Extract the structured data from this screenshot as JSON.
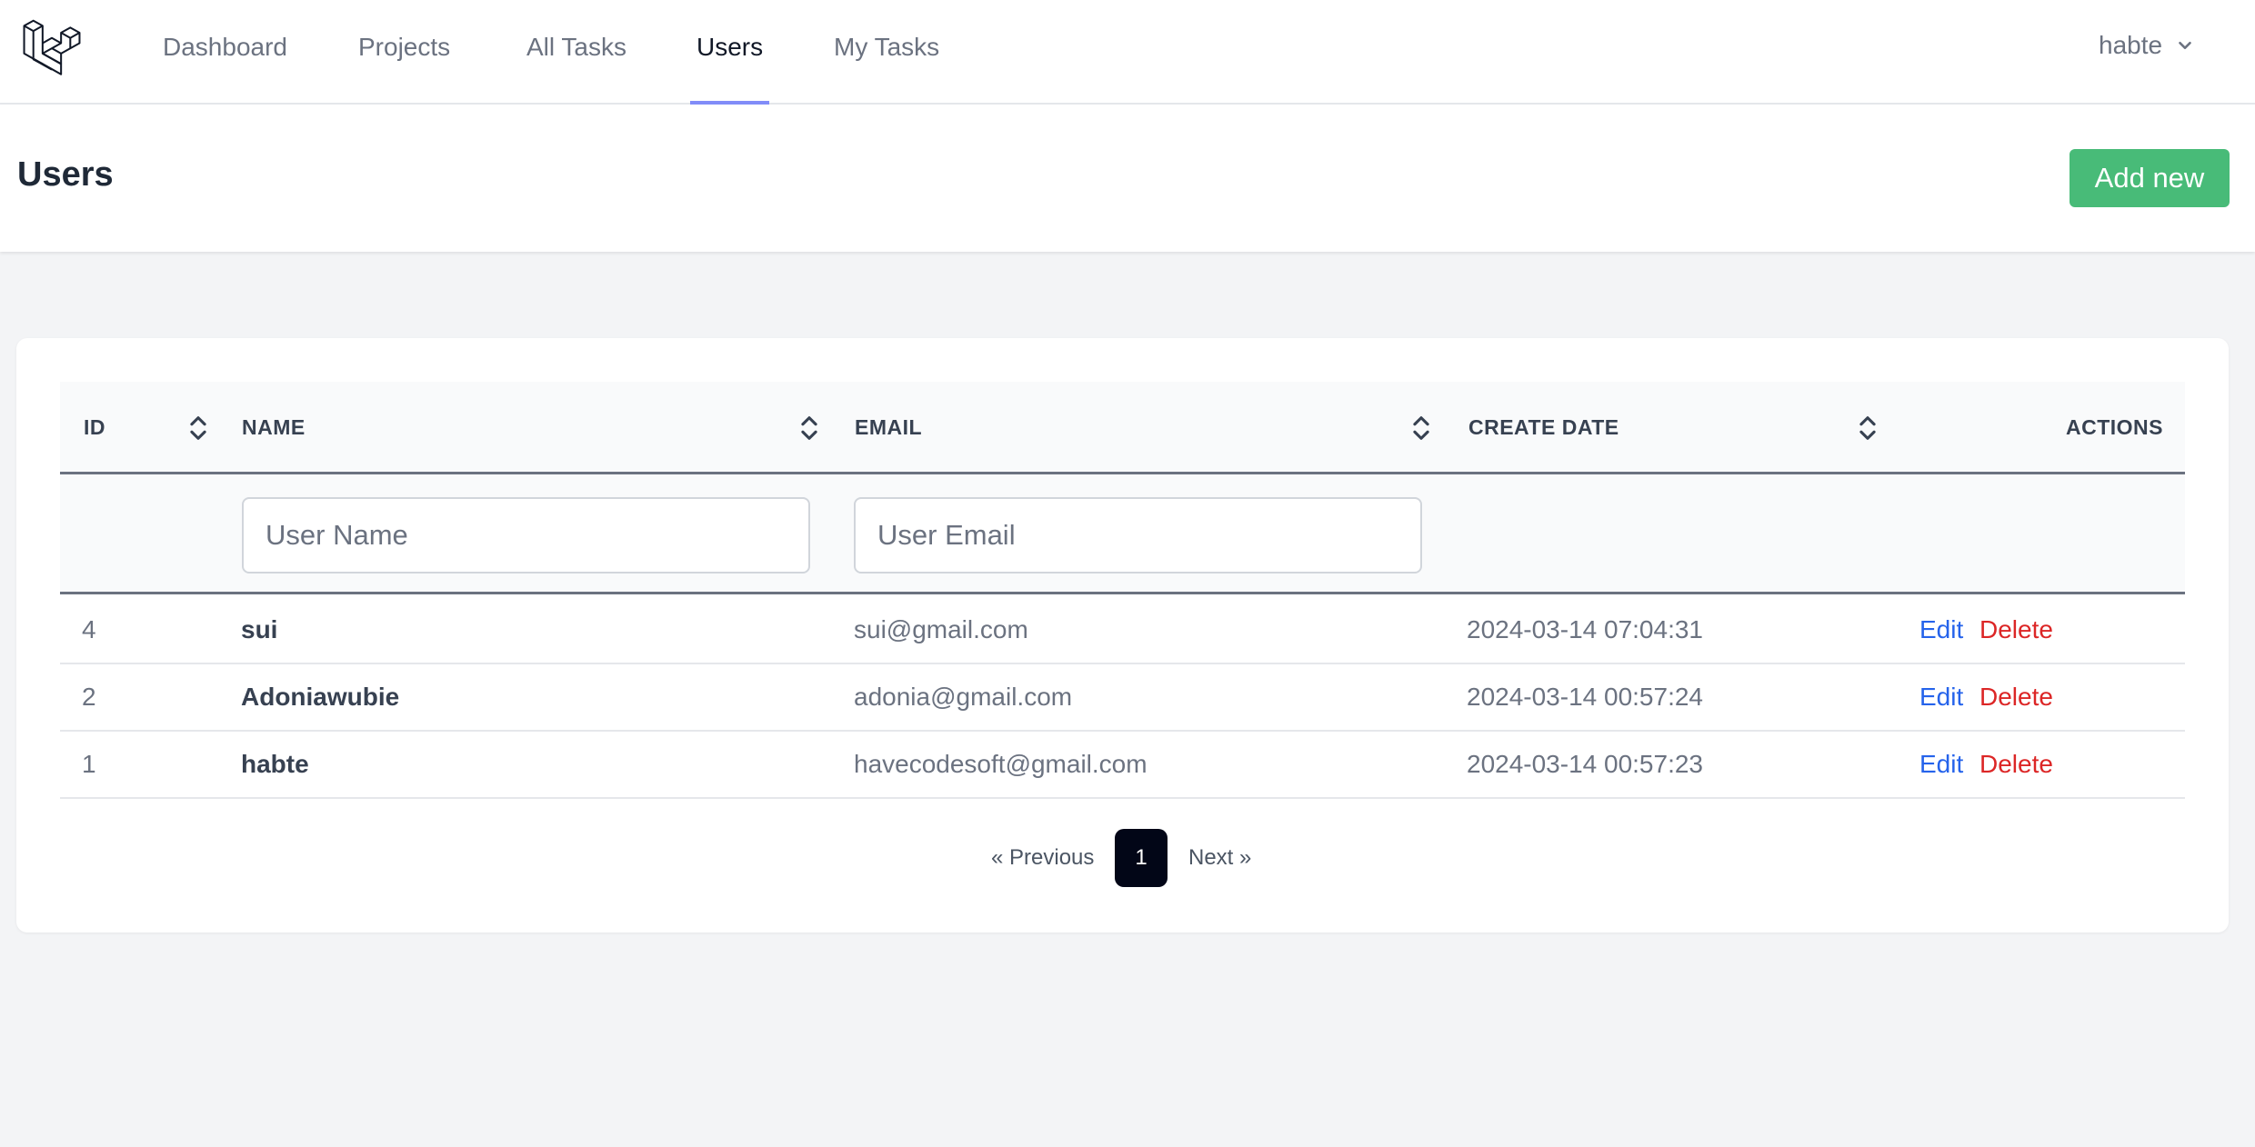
{
  "nav": {
    "links": [
      "Dashboard",
      "Projects",
      "All Tasks",
      "Users",
      "My Tasks"
    ],
    "active": "Users",
    "user_name": "habte"
  },
  "header": {
    "title": "Users",
    "add_button": "Add new"
  },
  "table": {
    "columns": [
      "ID",
      "NAME",
      "EMAIL",
      "CREATE DATE",
      "ACTIONS"
    ],
    "filters": {
      "name_placeholder": "User Name",
      "email_placeholder": "User Email"
    },
    "rows": [
      {
        "id": "4",
        "name": "sui",
        "email": "sui@gmail.com",
        "created": "2024-03-14 07:04:31",
        "edit": "Edit",
        "delete": "Delete"
      },
      {
        "id": "2",
        "name": "Adoniawubie",
        "email": "adonia@gmail.com",
        "created": "2024-03-14 00:57:24",
        "edit": "Edit",
        "delete": "Delete"
      },
      {
        "id": "1",
        "name": "habte",
        "email": "havecodesoft@gmail.com",
        "created": "2024-03-14 00:57:23",
        "edit": "Edit",
        "delete": "Delete"
      }
    ]
  },
  "pagination": {
    "previous": "« Previous",
    "current": "1",
    "next": "Next »"
  },
  "colors": {
    "accent_underline": "#818cf8",
    "add_button": "#48bb78",
    "edit_link": "#2563eb",
    "delete_link": "#dc2626",
    "current_page": "#020617"
  },
  "icons": {
    "logo": "laravel-logo-icon",
    "user_menu": "chevron-down-icon",
    "sort": "sort-icon"
  }
}
